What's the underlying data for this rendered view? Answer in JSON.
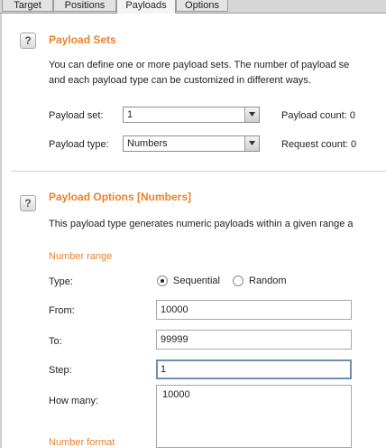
{
  "tabs": [
    {
      "label": "Target"
    },
    {
      "label": "Positions"
    },
    {
      "label": "Payloads",
      "active": true
    },
    {
      "label": "Options"
    }
  ],
  "help_icon_glyph": "?",
  "payload_sets": {
    "title": "Payload Sets",
    "desc_line1": "You can define one or more payload sets. The number of payload se",
    "desc_line2": "and each payload type can be customized in different ways.",
    "payload_set_label": "Payload set:",
    "payload_set_value": "1",
    "payload_count_label": "Payload count: 0",
    "payload_type_label": "Payload type:",
    "payload_type_value": "Numbers",
    "request_count_label": "Request count: 0"
  },
  "payload_options": {
    "title": "Payload Options [Numbers]",
    "desc": "This payload type generates numeric payloads within a given range a",
    "number_range_label": "Number range",
    "type_label": "Type:",
    "type_sequential": "Sequential",
    "type_random": "Random",
    "type_selected": "Sequential",
    "from_label": "From:",
    "from_value": "10000",
    "to_label": "To:",
    "to_value": "99999",
    "step_label": "Step:",
    "step_value": "1",
    "how_many_label": "How many:",
    "how_many_value": "10000",
    "number_format_label": "Number format"
  },
  "colors": {
    "heading": "#e8822d",
    "focus_border": "#6e8fb5",
    "tabbar": "#d6d6d6"
  },
  "icons": {
    "help": "help-icon",
    "dropdown": "chevron-down-icon",
    "radio": "radio-icon"
  }
}
